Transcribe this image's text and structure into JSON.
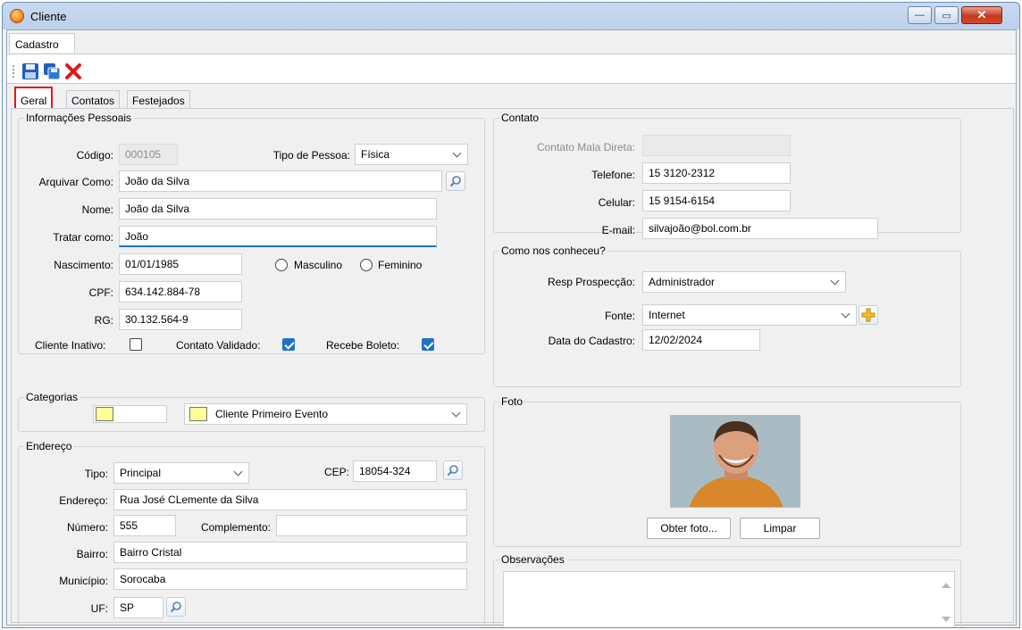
{
  "window": {
    "title": "Cliente",
    "minimize": "—",
    "maximize": "▭",
    "close": "✕"
  },
  "menu": {
    "tab": "Cadastro"
  },
  "toolbar": {
    "save": "save-icon",
    "save_copy": "save-copy-icon",
    "cancel": "delete-icon"
  },
  "tabs": [
    "Geral",
    "Contatos",
    "Festejados"
  ],
  "pessoais": {
    "legend": "Informações Pessoais",
    "codigo_label": "Código:",
    "codigo": "000105",
    "tipo_label": "Tipo de Pessoa:",
    "tipo": "Física",
    "arquivar_label": "Arquivar Como:",
    "arquivar": "João da Silva",
    "nome_label": "Nome:",
    "nome": "João da Silva",
    "tratar_label": "Tratar como:",
    "tratar": "João",
    "nascimento_label": "Nascimento:",
    "nascimento": "01/01/1985",
    "masculino": "Masculino",
    "feminino": "Feminino",
    "cpf_label": "CPF:",
    "cpf": "634.142.884-78",
    "rg_label": "RG:",
    "rg": "30.132.564-9",
    "inativo_label": "Cliente Inativo:",
    "validado_label": "Contato Validado:",
    "boleto_label": "Recebe Boleto:"
  },
  "categorias": {
    "legend": "Categorias",
    "selected": "Cliente Primeiro Evento",
    "color": "#ffff99"
  },
  "endereco": {
    "legend": "Endereço",
    "tipo_label": "Tipo:",
    "tipo": "Principal",
    "cep_label": "CEP:",
    "cep": "18054-324",
    "endereco_label": "Endereço:",
    "endereco": "Rua José CLemente da Silva",
    "numero_label": "Número:",
    "numero": "555",
    "complemento_label": "Complemento:",
    "complemento": "",
    "bairro_label": "Bairro:",
    "bairro": "Bairro Cristal",
    "municipio_label": "Município:",
    "municipio": "Sorocaba",
    "uf_label": "UF:",
    "uf": "SP"
  },
  "contato": {
    "legend": "Contato",
    "mala_label": "Contato Mala Direta:",
    "mala": "",
    "telefone_label": "Telefone:",
    "telefone": "15 3120-2312",
    "celular_label": "Celular:",
    "celular": "15 9154-6154",
    "email_label": "E-mail:",
    "email": "silvajoão@bol.com.br"
  },
  "conheceu": {
    "legend": "Como nos conheceu?",
    "resp_label": "Resp Prospecção:",
    "resp": "Administrador",
    "fonte_label": "Fonte:",
    "fonte": "Internet",
    "data_label": "Data do Cadastro:",
    "data": "12/02/2024"
  },
  "foto": {
    "legend": "Foto",
    "obter": "Obter foto...",
    "limpar": "Limpar"
  },
  "observacoes": {
    "legend": "Observações",
    "text": ""
  }
}
